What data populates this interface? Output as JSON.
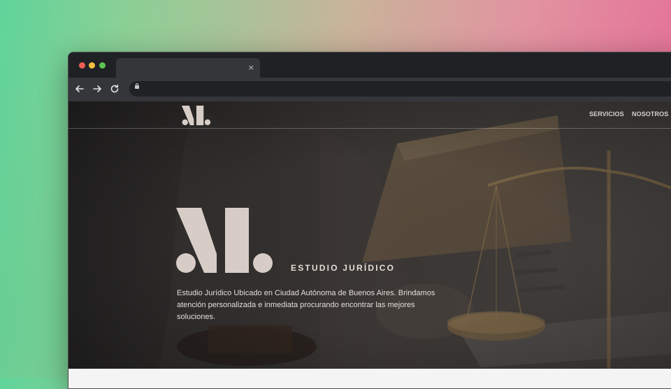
{
  "browser": {
    "tab": {
      "title": "",
      "close_glyph": "×",
      "close_icon": "close-icon"
    },
    "toolbar": {
      "back_icon": "arrow-left-icon",
      "forward_icon": "arrow-right-icon",
      "reload_icon": "reload-icon",
      "lock_icon": "lock-icon",
      "url": ""
    },
    "window_controls": [
      "close-dot",
      "minimize-dot",
      "maximize-dot"
    ]
  },
  "site": {
    "logo": ".M.",
    "nav": [
      {
        "label": "SERVICIOS"
      },
      {
        "label": "NOSOTROS"
      }
    ],
    "hero": {
      "tagline": "ESTUDIO JURÍDICO",
      "description": "Estudio Jurídico Ubicado en Ciudad Autónoma de Buenos Aires. Brindamos atención personalizada e inmediata procurando encontrar las mejores soluciones."
    }
  },
  "colors": {
    "logo": "#d8cdc6",
    "overlay": "#2a2827",
    "browser_chrome": "#35363a",
    "tab_strip": "#202124",
    "dot_red": "#ee5f55",
    "dot_yellow": "#f5be3f",
    "dot_green": "#5ec452"
  }
}
